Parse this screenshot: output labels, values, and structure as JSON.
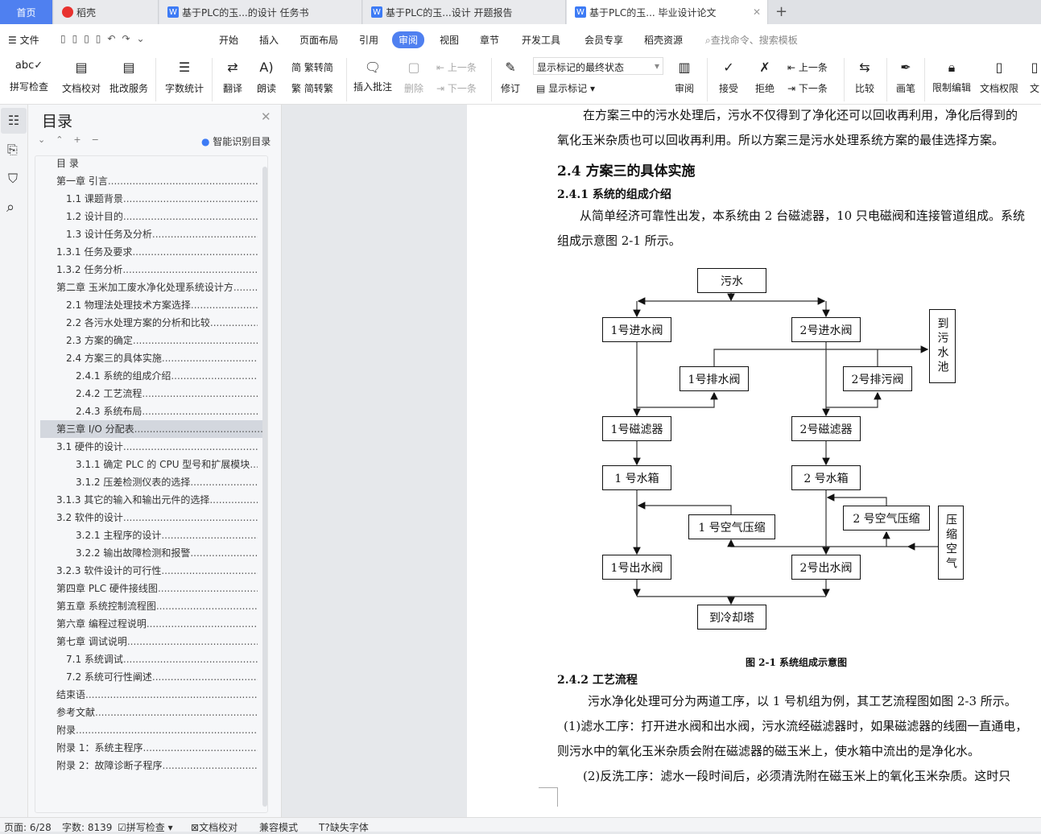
{
  "tabs": [
    {
      "label": "首页"
    },
    {
      "label": "稻壳"
    },
    {
      "label": "基于PLC的玉...的设计 任务书"
    },
    {
      "label": "基于PLC的玉...设计 开题报告"
    },
    {
      "label": "基于PLC的玉... 毕业设计论文"
    }
  ],
  "menu": {
    "file": "文件",
    "items": [
      "开始",
      "插入",
      "页面布局",
      "引用",
      "审阅",
      "视图",
      "章节",
      "开发工具",
      "会员专享",
      "稻壳资源"
    ],
    "active": "审阅",
    "search_placeholder": "查找命令、搜索模板"
  },
  "ribbon": {
    "spell": "拼写检查",
    "proof": "文档校对",
    "correct": "批改服务",
    "wordcount": "字数统计",
    "translate": "翻译",
    "read": "朗读",
    "t2s": "繁转简",
    "s2t": "简转繁",
    "add_comment": "插入批注",
    "delete": "删除",
    "prev": "上一条",
    "next": "下一条",
    "track": "修订",
    "markup_state": "显示标记的最终状态",
    "show_markup": "显示标记",
    "review": "审阅",
    "accept": "接受",
    "reject": "拒绝",
    "prev2": "上一条",
    "next2": "下一条",
    "compare": "比较",
    "pen": "画笔",
    "restrict": "限制编辑",
    "permission": "文档权限",
    "doc": "文"
  },
  "nav": {
    "title": "目录",
    "smart": "智能识别目录",
    "items": [
      {
        "t": "目  录",
        "l": 0
      },
      {
        "t": "第一章   引言",
        "l": 0
      },
      {
        "t": "1.1 课题背景",
        "l": 1
      },
      {
        "t": "1.2 设计目的",
        "l": 1
      },
      {
        "t": "1.3 设计任务及分析",
        "l": 1
      },
      {
        "t": "1.3.1 任务及要求",
        "l": 0
      },
      {
        "t": "1.3.2 任务分析",
        "l": 0
      },
      {
        "t": "第二章   玉米加工废水净化处理系统设计方",
        "l": 0
      },
      {
        "t": "2.1 物理法处理技术方案选择",
        "l": 1
      },
      {
        "t": "2.2 各污水处理方案的分析和比较",
        "l": 1
      },
      {
        "t": "2.3 方案的确定",
        "l": 1
      },
      {
        "t": "2.4 方案三的具体实施",
        "l": 1
      },
      {
        "t": "2.4.1 系统的组成介绍",
        "l": 2
      },
      {
        "t": "2.4.2 工艺流程",
        "l": 2
      },
      {
        "t": "2.4.3 系统布局",
        "l": 2
      },
      {
        "t": "第三章   I/O 分配表",
        "l": 0,
        "selected": true
      },
      {
        "t": "3.1 硬件的设计",
        "l": 0
      },
      {
        "t": "3.1.1 确定 PLC 的 CPU 型号和扩展模块",
        "l": 2
      },
      {
        "t": "3.1.2 压差检测仪表的选择",
        "l": 2
      },
      {
        "t": "3.1.3 其它的输入和输出元件的选择",
        "l": 0
      },
      {
        "t": "3.2 软件的设计",
        "l": 0
      },
      {
        "t": "3.2.1 主程序的设计",
        "l": 2
      },
      {
        "t": "3.2.2 输出故障检测和报警",
        "l": 2
      },
      {
        "t": "3.2.3 软件设计的可行性",
        "l": 0
      },
      {
        "t": "第四章   PLC 硬件接线图",
        "l": 0
      },
      {
        "t": "第五章   系统控制流程图",
        "l": 0
      },
      {
        "t": "第六章   编程过程说明",
        "l": 0
      },
      {
        "t": "第七章   调试说明",
        "l": 0
      },
      {
        "t": "7.1 系统调试",
        "l": 1
      },
      {
        "t": "7.2 系统可行性阐述",
        "l": 1
      },
      {
        "t": "结束语",
        "l": 0
      },
      {
        "t": "参考文献",
        "l": 0
      },
      {
        "t": "附录",
        "l": 0
      },
      {
        "t": "附录 1：系统主程序",
        "l": 0
      },
      {
        "t": "附录 2：故障诊断子程序",
        "l": 0
      }
    ]
  },
  "doc": {
    "p1a": "在方案三中的污水处理后，污水不仅得到了净化还可以回收再利用，净化后得到的",
    "p1b": "氧化玉米杂质也可以回收再利用。所以方案三是污水处理系统方案的最佳选择方案。",
    "h24": "2.4 方案三的具体实施",
    "h241": "2.4.1 系统的组成介绍",
    "p2a": "从简单经济可靠性出发，本系统由 2 台磁滤器，10 只电磁阀和连接管道组成。系统",
    "p2b": "组成示意图 2-1 所示。",
    "diagram": {
      "sewage": "污水",
      "in1": "1号进水阀",
      "in2": "2号进水阀",
      "pool": "到污水池",
      "drain1": "1号排水阀",
      "drain2": "2号排污阀",
      "filter1": "1号磁滤器",
      "filter2": "2号磁滤器",
      "tank1": "1 号水箱",
      "tank2": "2 号水箱",
      "air1": "1 号空气压缩",
      "air2": "2 号空气压缩",
      "compressed": "压缩空气",
      "out1": "1号出水阀",
      "out2": "2号出水阀",
      "tower": "到冷却塔"
    },
    "caption": "图 2-1 系统组成示意图",
    "h242": "2.4.2 工艺流程",
    "p3": "污水净化处理可分为两道工序，以 1 号机组为例，其工艺流程图如图 2-3 所示。",
    "p4a": "(1)滤水工序：打开进水阀和出水阀，污水流经磁滤器时，如果磁滤器的线圈一直通电，",
    "p4b": "则污水中的氧化玉米杂质会附在磁滤器的磁玉米上，使水箱中流出的是净化水。",
    "p5": "(2)反洗工序：滤水一段时间后，必须清洗附在磁玉米上的氧化玉米杂质。这时只"
  },
  "status": {
    "page": "页面: 6/28",
    "words": "字数: 8139",
    "spell": "拼写检查",
    "proof": "文档校对",
    "compat": "兼容模式",
    "font": "缺失字体"
  },
  "colors": {
    "accent": "#4f80f0"
  }
}
